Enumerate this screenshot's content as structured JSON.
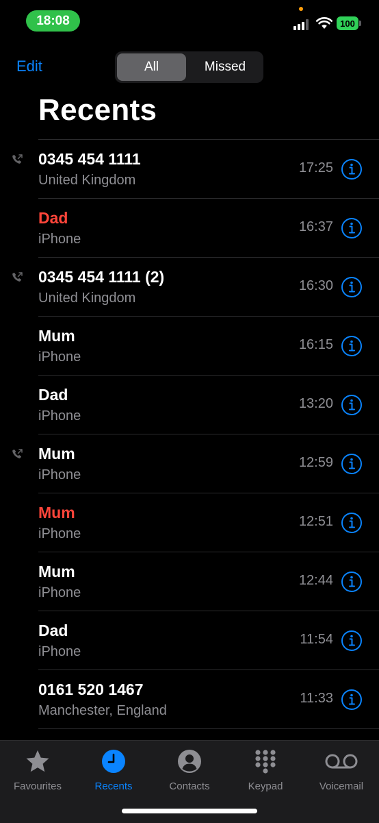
{
  "status": {
    "time": "18:08",
    "battery": "100",
    "signal_icon": "cellular-signal-icon",
    "wifi_icon": "wifi-icon",
    "time_pill_color": "#30c14a",
    "battery_color": "#30d158"
  },
  "header": {
    "edit_label": "Edit",
    "segments": [
      "All",
      "Missed"
    ],
    "selected_segment": "All",
    "title": "Recents",
    "accent_color": "#0a84ff"
  },
  "calls": [
    {
      "name": "0345 454 1111",
      "detail": "United Kingdom",
      "time": "17:25",
      "missed": false,
      "outgoing": true
    },
    {
      "name": "Dad",
      "detail": "iPhone",
      "time": "16:37",
      "missed": true,
      "outgoing": false
    },
    {
      "name": "0345 454 1111 (2)",
      "detail": "United Kingdom",
      "time": "16:30",
      "missed": false,
      "outgoing": true
    },
    {
      "name": "Mum",
      "detail": "iPhone",
      "time": "16:15",
      "missed": false,
      "outgoing": false
    },
    {
      "name": "Dad",
      "detail": "iPhone",
      "time": "13:20",
      "missed": false,
      "outgoing": false
    },
    {
      "name": "Mum",
      "detail": "iPhone",
      "time": "12:59",
      "missed": false,
      "outgoing": true
    },
    {
      "name": "Mum",
      "detail": "iPhone",
      "time": "12:51",
      "missed": true,
      "outgoing": false
    },
    {
      "name": "Mum",
      "detail": "iPhone",
      "time": "12:44",
      "missed": false,
      "outgoing": false
    },
    {
      "name": "Dad",
      "detail": "iPhone",
      "time": "11:54",
      "missed": false,
      "outgoing": false
    },
    {
      "name": "0161 520 1467",
      "detail": "Manchester, England",
      "time": "11:33",
      "missed": false,
      "outgoing": false
    }
  ],
  "missed_color": "#ff453a",
  "tabs": [
    {
      "label": "Favourites",
      "icon": "star-icon",
      "active": false
    },
    {
      "label": "Recents",
      "icon": "clock-icon",
      "active": true
    },
    {
      "label": "Contacts",
      "icon": "person-circle-icon",
      "active": false
    },
    {
      "label": "Keypad",
      "icon": "keypad-grid-icon",
      "active": false
    },
    {
      "label": "Voicemail",
      "icon": "voicemail-icon",
      "active": false
    }
  ]
}
